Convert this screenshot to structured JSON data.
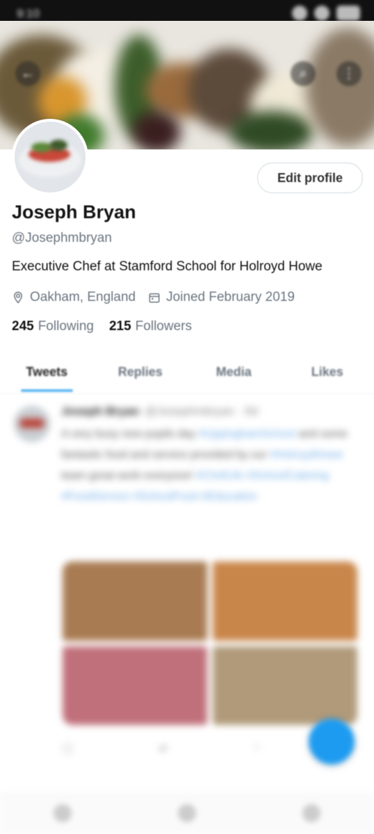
{
  "status_bar": {
    "time": "9:10"
  },
  "header": {
    "back_icon": "arrow-left-icon",
    "search_icon": "search-icon",
    "more_icon": "more-vertical-icon"
  },
  "profile": {
    "edit_label": "Edit profile",
    "name": "Joseph Bryan",
    "handle": "@Josephmbryan",
    "bio": "Executive Chef at Stamford School for Holroyd Howe",
    "location": "Oakham, England",
    "joined": "Joined February 2019",
    "following_count": "245",
    "following_label": "Following",
    "followers_count": "215",
    "followers_label": "Followers"
  },
  "tabs": [
    {
      "label": "Tweets",
      "active": true
    },
    {
      "label": "Replies",
      "active": false
    },
    {
      "label": "Media",
      "active": false
    },
    {
      "label": "Likes",
      "active": false
    }
  ],
  "tweet": {
    "author": "Joseph Bryan",
    "handle_time": "@Josephmbryan · 6d",
    "text_plain": "A very busy new pupils day",
    "tag1": "#UppinghamSchool",
    "text_plain2": "and some fantastic food and service provided by our",
    "tag2": "#HolroydHowe",
    "text_plain3": "team great work everyone!",
    "tags_more": "#ChefLife #SchoolCatering #FoodService #SchoolFood #Education"
  },
  "colors": {
    "accent": "#1d9bf0",
    "muted": "#6b7580"
  }
}
